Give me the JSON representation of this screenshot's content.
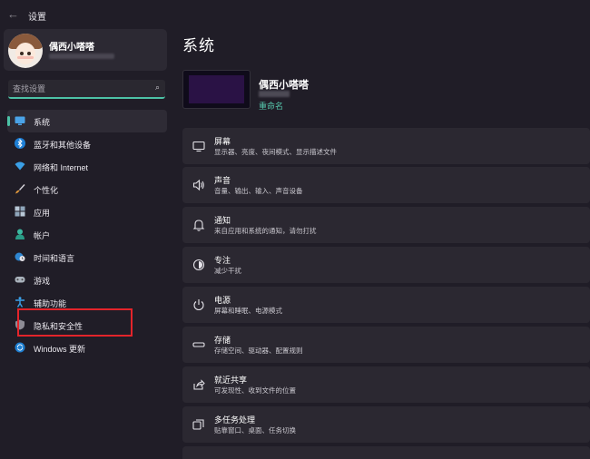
{
  "app": {
    "title": "设置"
  },
  "profile": {
    "name": "偶西小嗒嗒"
  },
  "search": {
    "placeholder": "查找设置"
  },
  "nav": {
    "items": [
      {
        "label": "系统",
        "icon": "monitor-icon",
        "active": true
      },
      {
        "label": "蓝牙和其他设备",
        "icon": "bluetooth-icon"
      },
      {
        "label": "网络和 Internet",
        "icon": "wifi-icon"
      },
      {
        "label": "个性化",
        "icon": "brush-icon"
      },
      {
        "label": "应用",
        "icon": "apps-icon"
      },
      {
        "label": "帐户",
        "icon": "account-icon"
      },
      {
        "label": "时间和语言",
        "icon": "globe-clock-icon"
      },
      {
        "label": "游戏",
        "icon": "gamepad-icon"
      },
      {
        "label": "辅助功能",
        "icon": "accessibility-icon"
      },
      {
        "label": "隐私和安全性",
        "icon": "shield-icon"
      },
      {
        "label": "Windows 更新",
        "icon": "update-icon"
      }
    ]
  },
  "main": {
    "title": "系统",
    "device": {
      "name": "偶西小嗒嗒",
      "rename": "重命名"
    },
    "cards": [
      {
        "title": "屏幕",
        "desc": "显示器、亮度、夜间模式、显示描述文件",
        "icon": "display-icon"
      },
      {
        "title": "声音",
        "desc": "音量、输出、输入、声音设备",
        "icon": "speaker-icon"
      },
      {
        "title": "通知",
        "desc": "来自应用和系统的通知，请勿打扰",
        "icon": "bell-icon"
      },
      {
        "title": "专注",
        "desc": "减少干扰",
        "icon": "focus-icon"
      },
      {
        "title": "电源",
        "desc": "屏幕和睡眠、电源模式",
        "icon": "power-icon"
      },
      {
        "title": "存储",
        "desc": "存储空间、驱动器、配置规则",
        "icon": "storage-icon"
      },
      {
        "title": "就近共享",
        "desc": "可发现性、收到文件的位置",
        "icon": "share-icon"
      },
      {
        "title": "多任务处理",
        "desc": "贴靠窗口、桌面、任务切换",
        "icon": "multitask-icon"
      }
    ]
  },
  "colors": {
    "accent": "#4cc2a6",
    "background": "#201d27",
    "card": "#2b2831",
    "highlight": "#e3242b"
  }
}
